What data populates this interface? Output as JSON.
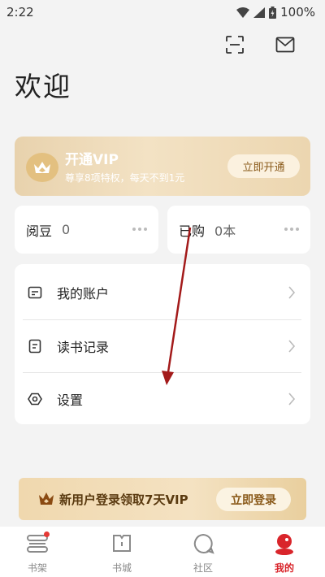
{
  "status_bar": {
    "time": "2:22",
    "battery": "100%"
  },
  "header": {
    "title": "欢迎",
    "icons": [
      "scan-icon",
      "mail-icon"
    ]
  },
  "vip_card": {
    "title": "开通VIP",
    "subtitle": "尊享8项特权，每天不到1元",
    "button_label": "立即开通"
  },
  "stats": [
    {
      "label": "阅豆",
      "value": "0"
    },
    {
      "label": "已购",
      "value": "0本"
    }
  ],
  "menu": {
    "items": [
      {
        "label": "我的账户",
        "icon": "account-icon"
      },
      {
        "label": "读书记录",
        "icon": "history-icon"
      },
      {
        "label": "设置",
        "icon": "settings-icon"
      }
    ]
  },
  "promo": {
    "text": "新用户登录领取7天VIP",
    "button_label": "立即登录"
  },
  "bottom_nav": {
    "items": [
      {
        "label": "书架",
        "icon": "bookshelf-icon",
        "badge": true
      },
      {
        "label": "书城",
        "icon": "bookstore-icon"
      },
      {
        "label": "社区",
        "icon": "community-icon"
      },
      {
        "label": "我的",
        "icon": "profile-icon",
        "active": true
      }
    ]
  },
  "colors": {
    "accent_red": "#d9252b",
    "vip_gold": "#e8d2ad",
    "background": "#f3f3f3"
  }
}
